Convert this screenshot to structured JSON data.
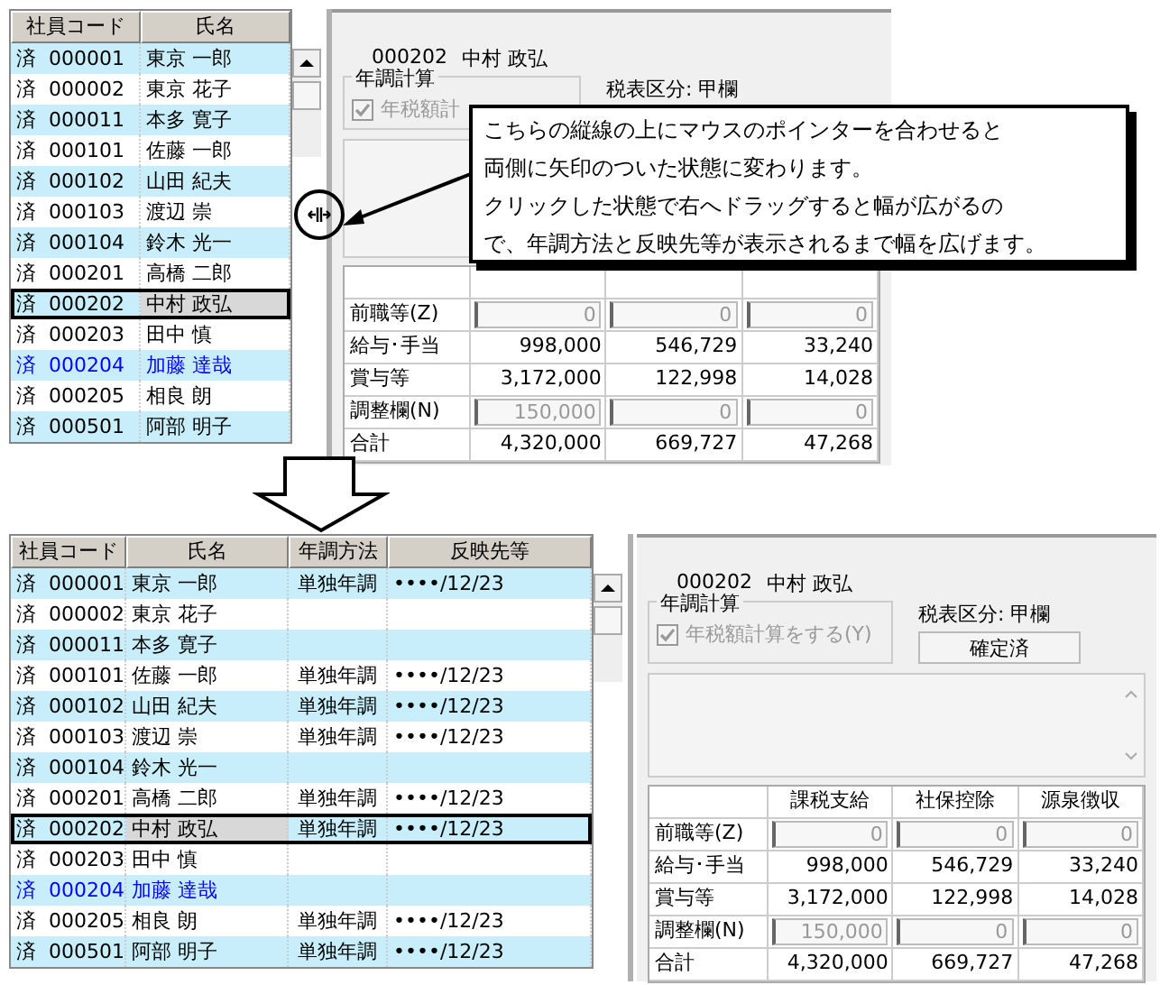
{
  "screens": [
    {
      "list": {
        "columns": [
          "社員コード",
          "氏名"
        ],
        "rows": [
          {
            "code": "済  000001",
            "name": "東京 一郎",
            "color": "#000000",
            "selected": false
          },
          {
            "code": "済  000002",
            "name": "東京 花子",
            "color": "#000000",
            "selected": false
          },
          {
            "code": "済  000011",
            "name": "本多 寛子",
            "color": "#000000",
            "selected": false
          },
          {
            "code": "済  000101",
            "name": "佐藤 一郎",
            "color": "#000000",
            "selected": false
          },
          {
            "code": "済  000102",
            "name": "山田 紀夫",
            "color": "#000000",
            "selected": false
          },
          {
            "code": "済  000103",
            "name": "渡辺 崇",
            "color": "#000000",
            "selected": false
          },
          {
            "code": "済  000104",
            "name": "鈴木 光一",
            "color": "#000000",
            "selected": false
          },
          {
            "code": "済  000201",
            "name": "高橋 二郎",
            "color": "#000000",
            "selected": false
          },
          {
            "code": "済  000202",
            "name": "中村 政弘",
            "color": "#000000",
            "selected": true
          },
          {
            "code": "済  000203",
            "name": "田中 慎",
            "color": "#000000",
            "selected": false
          },
          {
            "code": "済  000204",
            "name": "加藤 達哉",
            "color": "#0000ff",
            "selected": false
          },
          {
            "code": "済  000205",
            "name": "相良 朗",
            "color": "#000000",
            "selected": false
          },
          {
            "code": "済  000501",
            "name": "阿部 明子",
            "color": "#000000",
            "selected": false
          }
        ]
      },
      "detail": {
        "code": "000202",
        "name": "中村 政弘",
        "group": "年調計算",
        "checkbox": {
          "label": "年税額計",
          "checked": true
        },
        "tax_class": "税表区分: 甲欄",
        "table": {
          "rows": [
            {
              "label": "前職等(Z)",
              "kind": "input",
              "values": [
                "0",
                "0",
                "0"
              ]
            },
            {
              "label": "給与･手当",
              "kind": "value",
              "values": [
                "998,000",
                "546,729",
                "33,240"
              ]
            },
            {
              "label": "賞与等",
              "kind": "value",
              "values": [
                "3,172,000",
                "122,998",
                "14,028"
              ]
            },
            {
              "label": "調整欄(N)",
              "kind": "input",
              "values": [
                "150,000",
                "0",
                "0"
              ]
            },
            {
              "label": "合計",
              "kind": "value",
              "values": [
                "4,320,000",
                "669,727",
                "47,268"
              ]
            }
          ]
        }
      }
    },
    {
      "list": {
        "columns": [
          "社員コード",
          "氏名",
          "年調方法",
          "反映先等"
        ],
        "rows": [
          {
            "code": "済  000001",
            "name": "東京 一郎",
            "method": "単独年調",
            "reflect": "••••/12/23",
            "color": "#000000",
            "selected": false
          },
          {
            "code": "済  000002",
            "name": "東京 花子",
            "color": "#000000",
            "selected": false
          },
          {
            "code": "済  000011",
            "name": "本多 寛子",
            "color": "#000000",
            "selected": false
          },
          {
            "code": "済  000101",
            "name": "佐藤 一郎",
            "method": "単独年調",
            "reflect": "••••/12/23",
            "color": "#000000",
            "selected": false
          },
          {
            "code": "済  000102",
            "name": "山田 紀夫",
            "method": "単独年調",
            "reflect": "••••/12/23",
            "color": "#000000",
            "selected": false
          },
          {
            "code": "済  000103",
            "name": "渡辺 崇",
            "method": "単独年調",
            "reflect": "••••/12/23",
            "color": "#000000",
            "selected": false
          },
          {
            "code": "済  000104",
            "name": "鈴木 光一",
            "color": "#000000",
            "selected": false
          },
          {
            "code": "済  000201",
            "name": "高橋 二郎",
            "method": "単独年調",
            "reflect": "••••/12/23",
            "color": "#000000",
            "selected": false
          },
          {
            "code": "済  000202",
            "name": "中村 政弘",
            "method": "単独年調",
            "reflect": "••••/12/23",
            "color": "#000000",
            "selected": true
          },
          {
            "code": "済  000203",
            "name": "田中 慎",
            "color": "#000000",
            "selected": false
          },
          {
            "code": "済  000204",
            "name": "加藤 達哉",
            "color": "#0000ff",
            "selected": false
          },
          {
            "code": "済  000205",
            "name": "相良 朗",
            "method": "単独年調",
            "reflect": "••••/12/23",
            "color": "#000000",
            "selected": false
          },
          {
            "code": "済  000501",
            "name": "阿部 明子",
            "method": "単独年調",
            "reflect": "••••/12/23",
            "color": "#000000",
            "selected": false
          }
        ]
      },
      "detail": {
        "code": "000202",
        "name": "中村 政弘",
        "group": "年調計算",
        "checkbox": {
          "label": "年税額計算をする(Y)",
          "checked": true
        },
        "tax_class": "税表区分: 甲欄",
        "status_button": "確定済",
        "table": {
          "columns": [
            "課税支給",
            "社保控除",
            "源泉徴収"
          ],
          "rows": [
            {
              "label": "前職等(Z)",
              "kind": "input",
              "values": [
                "0",
                "0",
                "0"
              ]
            },
            {
              "label": "給与･手当",
              "kind": "value",
              "values": [
                "998,000",
                "546,729",
                "33,240"
              ]
            },
            {
              "label": "賞与等",
              "kind": "value",
              "values": [
                "3,172,000",
                "122,998",
                "14,028"
              ]
            },
            {
              "label": "調整欄(N)",
              "kind": "input",
              "values": [
                "150,000",
                "0",
                "0"
              ]
            },
            {
              "label": "合計",
              "kind": "value",
              "values": [
                "4,320,000",
                "669,727",
                "47,268"
              ]
            }
          ]
        }
      }
    }
  ],
  "callout": {
    "lines": [
      "こちらの縦線の上にマウスのポインターを合わせると",
      "両側に矢印のついた状態に変わります。",
      "クリックした状態で右へドラッグすると幅が広がるの",
      "で、年調方法と反映先等が表示されるまで幅を広げます。"
    ]
  }
}
